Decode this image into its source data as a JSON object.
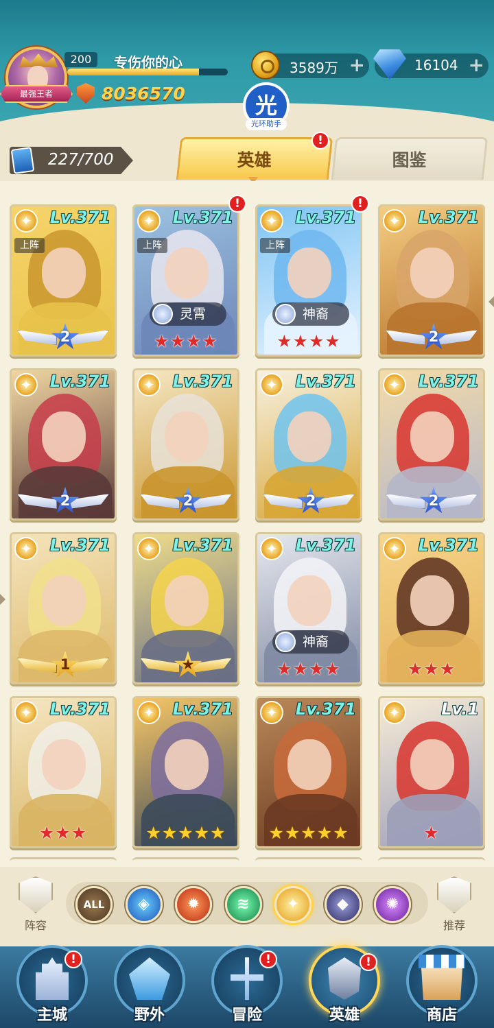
{
  "player": {
    "level": "200",
    "name": "专伤你的心",
    "rank_title": "最强王者",
    "power": "8036570",
    "exp_fraction": 0.82
  },
  "resources": {
    "gold": "3589万",
    "diamond": "16104",
    "plus": "+"
  },
  "helper": {
    "glyph": "光",
    "label": "光环助手"
  },
  "hero_count": "227/700",
  "tabs": [
    {
      "label": "英雄",
      "active": true,
      "alert": "!"
    },
    {
      "label": "图鉴",
      "active": false
    }
  ],
  "cards": [
    {
      "level": "Lv.371",
      "deployed": "上阵",
      "faction": "",
      "stars": 0,
      "badge": "2",
      "badge_style": "blue",
      "alert": "",
      "colors": [
        "#f6d46a",
        "#c9962e",
        "#e8c24a"
      ]
    },
    {
      "level": "Lv.371",
      "deployed": "上阵",
      "faction": "灵霄",
      "stars": 4,
      "star_color": "red",
      "badge": "",
      "alert": "!",
      "colors": [
        "#9cc2e0",
        "#e9e6ee",
        "#6d86b8"
      ]
    },
    {
      "level": "Lv.371",
      "deployed": "上阵",
      "faction": "神裔",
      "stars": 4,
      "star_color": "red",
      "badge": "",
      "alert": "!",
      "colors": [
        "#7ec4f2",
        "#6fb7f0",
        "#e6f3ff"
      ]
    },
    {
      "level": "Lv.371",
      "deployed": "",
      "faction": "",
      "stars": 0,
      "badge": "2",
      "badge_style": "blue",
      "alert": "",
      "colors": [
        "#f4cd83",
        "#d8a56a",
        "#b8742e"
      ]
    },
    {
      "level": "Lv.371",
      "deployed": "",
      "faction": "",
      "stars": 0,
      "badge": "2",
      "badge_style": "blue",
      "alert": "",
      "colors": [
        "#f0d6a2",
        "#c73c4a",
        "#5a3a38"
      ]
    },
    {
      "level": "Lv.371",
      "deployed": "",
      "faction": "",
      "stars": 0,
      "badge": "2",
      "badge_style": "blue",
      "alert": "",
      "colors": [
        "#f5e7c4",
        "#e8e2d8",
        "#c9952e"
      ]
    },
    {
      "level": "Lv.371",
      "deployed": "",
      "faction": "",
      "stars": 0,
      "badge": "2",
      "badge_style": "blue",
      "alert": "",
      "colors": [
        "#f7f1e2",
        "#6ec3ef",
        "#d7a635"
      ]
    },
    {
      "level": "Lv.371",
      "deployed": "",
      "faction": "",
      "stars": 0,
      "badge": "2",
      "badge_style": "blue",
      "alert": "",
      "colors": [
        "#f4dba8",
        "#d8342e",
        "#b5b7c8"
      ]
    },
    {
      "level": "Lv.371",
      "deployed": "",
      "faction": "",
      "stars": 0,
      "badge": "1",
      "badge_style": "gold",
      "alert": "",
      "colors": [
        "#f4e4bc",
        "#f1e08c",
        "#ddb86a"
      ]
    },
    {
      "level": "Lv.371",
      "deployed": "",
      "faction": "",
      "stars": 0,
      "badge": "★",
      "badge_style": "gold",
      "alert": "",
      "colors": [
        "#eedc8a",
        "#f5d34c",
        "#6a6f85"
      ]
    },
    {
      "level": "Lv.371",
      "deployed": "",
      "faction": "神裔",
      "stars": 4,
      "star_color": "red",
      "badge": "",
      "alert": "",
      "colors": [
        "#e6e8ee",
        "#f3f4f8",
        "#808aa2"
      ]
    },
    {
      "level": "Lv.371",
      "deployed": "",
      "faction": "",
      "stars": 3,
      "star_color": "red",
      "badge": "",
      "alert": "",
      "colors": [
        "#f7d58c",
        "#5a3020",
        "#e2b05a"
      ]
    },
    {
      "level": "Lv.371",
      "deployed": "",
      "faction": "",
      "stars": 3,
      "star_color": "red",
      "badge": "",
      "alert": "",
      "colors": [
        "#f5e6c2",
        "#f0efe8",
        "#d8b463"
      ]
    },
    {
      "level": "Lv.371",
      "deployed": "",
      "faction": "",
      "stars": 5,
      "star_color": "gold",
      "badge": "",
      "alert": "",
      "colors": [
        "#f7c666",
        "#7d6da0",
        "#3c4a5a"
      ]
    },
    {
      "level": "Lv.371",
      "deployed": "",
      "faction": "",
      "stars": 5,
      "star_color": "gold",
      "badge": "",
      "alert": "",
      "colors": [
        "#b98858",
        "#c86a3a",
        "#6b3a22"
      ]
    },
    {
      "level": "Lv.1",
      "deployed": "",
      "faction": "",
      "stars": 1,
      "star_color": "red",
      "badge": "",
      "alert": "",
      "colors": [
        "#f7ecd6",
        "#d8342e",
        "#9c9fb8"
      ]
    }
  ],
  "filters": {
    "left_label": "阵容",
    "right_label": "推荐",
    "items": [
      {
        "name": "all",
        "text": "ALL"
      },
      {
        "name": "water",
        "text": ""
      },
      {
        "name": "fire",
        "text": ""
      },
      {
        "name": "wind",
        "text": ""
      },
      {
        "name": "light",
        "text": "",
        "selected": true
      },
      {
        "name": "dark",
        "text": ""
      },
      {
        "name": "chaos",
        "text": ""
      }
    ]
  },
  "nav": [
    {
      "label": "主城",
      "alert": "!",
      "active": false
    },
    {
      "label": "野外",
      "alert": "",
      "active": false
    },
    {
      "label": "冒险",
      "alert": "!",
      "active": false
    },
    {
      "label": "英雄",
      "alert": "!",
      "active": true
    },
    {
      "label": "商店",
      "alert": "",
      "active": false
    }
  ],
  "colors": {
    "header_teal": "#2f9aa8",
    "level_text": "#7ff2e6",
    "alert_red": "#e0211f",
    "power_gold": "#ffd34d"
  }
}
